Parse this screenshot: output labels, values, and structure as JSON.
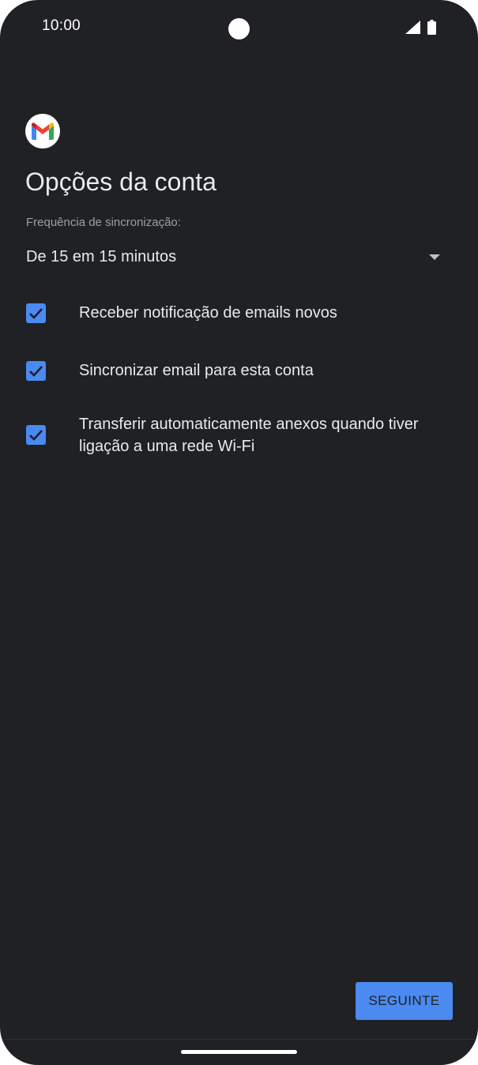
{
  "status_bar": {
    "time": "10:00"
  },
  "app": {
    "logo_icon": "gmail-logo-icon"
  },
  "page": {
    "title": "Opções da conta"
  },
  "sync": {
    "label": "Frequência de sincronização:",
    "selected_value": "De 15 em 15 minutos"
  },
  "options": [
    {
      "label": "Receber notificação de emails novos",
      "checked": true
    },
    {
      "label": "Sincronizar email para esta conta",
      "checked": true
    },
    {
      "label": "Transferir automaticamente anexos quando tiver ligação a uma rede Wi-Fi",
      "checked": true
    }
  ],
  "footer": {
    "next_label": "SEGUINTE"
  },
  "colors": {
    "background": "#202124",
    "accent": "#4b8af0",
    "text": "#e8eaed",
    "secondary_text": "#9aa0a6"
  }
}
